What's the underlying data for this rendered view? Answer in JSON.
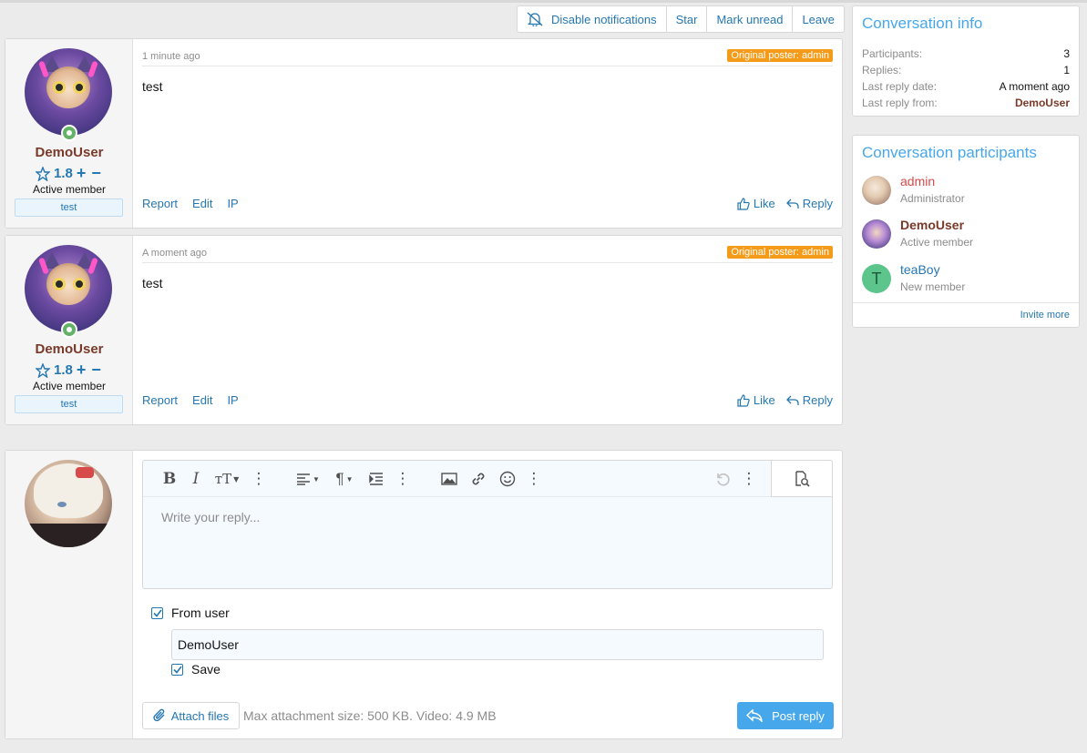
{
  "actions": {
    "disable_notifications": "Disable notifications",
    "star": "Star",
    "mark_unread": "Mark unread",
    "leave": "Leave"
  },
  "messages": [
    {
      "time": "1 minute ago",
      "op_badge": "Original poster: admin",
      "body": "test",
      "username": "DemoUser",
      "rating": "1.8",
      "user_title": "Active member",
      "banner": "test",
      "footer": {
        "report": "Report",
        "edit": "Edit",
        "ip": "IP",
        "like": "Like",
        "reply": "Reply"
      }
    },
    {
      "time": "A moment ago",
      "op_badge": "Original poster: admin",
      "body": "test",
      "username": "DemoUser",
      "rating": "1.8",
      "user_title": "Active member",
      "banner": "test",
      "footer": {
        "report": "Report",
        "edit": "Edit",
        "ip": "IP",
        "like": "Like",
        "reply": "Reply"
      }
    }
  ],
  "reply": {
    "placeholder": "Write your reply...",
    "from_user_label": "From user",
    "from_user_value": "DemoUser",
    "save_label": "Save",
    "attach_label": "Attach files",
    "attach_info": "Max attachment size: 500 KB. Video: 4.9 MB",
    "post_label": "Post reply"
  },
  "conversation_info": {
    "title": "Conversation info",
    "rows": [
      {
        "key": "Participants:",
        "value": "3"
      },
      {
        "key": "Replies:",
        "value": "1"
      },
      {
        "key": "Last reply date:",
        "value": "A moment ago"
      },
      {
        "key": "Last reply from:",
        "value": "DemoUser"
      }
    ]
  },
  "participants": {
    "title": "Conversation participants",
    "items": [
      {
        "name": "admin",
        "role": "Administrator",
        "name_color": "#d84a4a"
      },
      {
        "name": "DemoUser",
        "role": "Active member",
        "name_color": "#7a3a2a"
      },
      {
        "name": "teaBoy",
        "role": "New member",
        "name_color": "#2577b1",
        "initial": "T",
        "avatar_color": "#5cc58c"
      }
    ],
    "invite": "Invite more"
  },
  "colors": {
    "accent": "#47a7eb",
    "link": "#2577b1",
    "op_badge": "#f59b1a",
    "online": "#63b265"
  }
}
